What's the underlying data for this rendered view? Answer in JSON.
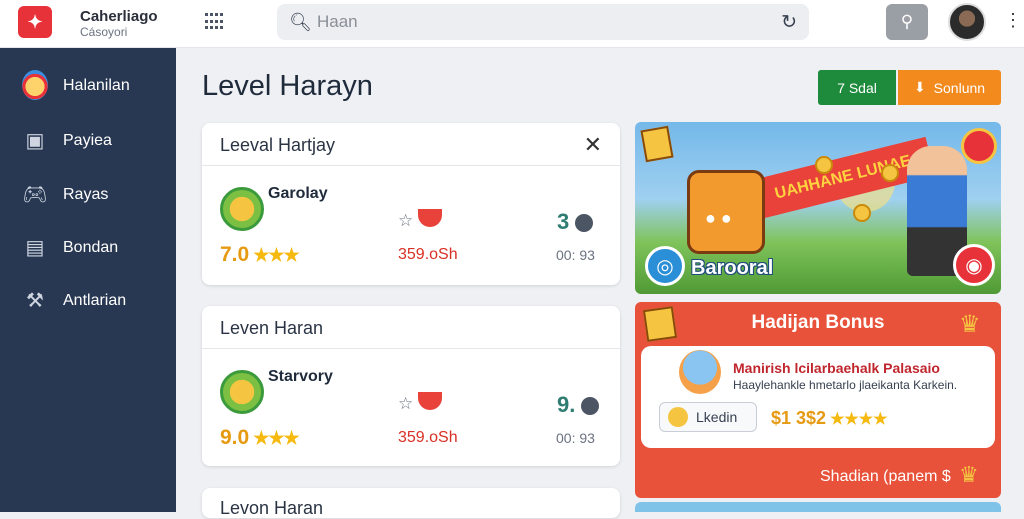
{
  "header": {
    "brand_title": "Caherliago",
    "brand_sub": "Cásoyori",
    "search_placeholder": "Haan",
    "icons": [
      "app-logo-icon",
      "grid-icon",
      "search-icon",
      "refresh-icon",
      "search-button-icon",
      "more-vertical-icon"
    ]
  },
  "sidebar": {
    "items": [
      {
        "label": "Halanilan",
        "icon": "mascot-icon"
      },
      {
        "label": "Payiea",
        "icon": "inbox-icon"
      },
      {
        "label": "Rayas",
        "icon": "gamepad-icon"
      },
      {
        "label": "Bondan",
        "icon": "id-card-icon"
      },
      {
        "label": "Antlarian",
        "icon": "tools-icon"
      }
    ]
  },
  "main": {
    "title": "Level Harayn",
    "btn_green": "7 Sdal",
    "btn_orange": "Sonlunn",
    "cards": [
      {
        "title": "Leeval Hartjay",
        "name": "Garolay",
        "rating": "7.0",
        "price": "359.oSh",
        "count": "3",
        "time": "00: 93"
      },
      {
        "title": "Leven Haran",
        "name": "Starvory",
        "rating": "9.0",
        "price": "359.oSh",
        "count": "9.",
        "time": "00: 93"
      },
      {
        "title": "Levon Haran"
      }
    ]
  },
  "promo": {
    "ribbon_text": "UAHHANE LUNAE",
    "title": "Barooral"
  },
  "bonus": {
    "title": "Hadijan Bonus",
    "headline": "Manirish lcilarbaehalk Palasaio",
    "desc": "Haaylehankle hmetarlo jlaeikanta Karkein.",
    "pill_label": "Lkedin",
    "amount": "$1 3$2",
    "footer": "Shadian (panem $"
  },
  "colors": {
    "sidebar_bg": "#293852",
    "accent_red": "#e8323a",
    "btn_green": "#1e8a3c",
    "btn_orange": "#f28a1e",
    "bonus_bg": "#e8523a"
  }
}
